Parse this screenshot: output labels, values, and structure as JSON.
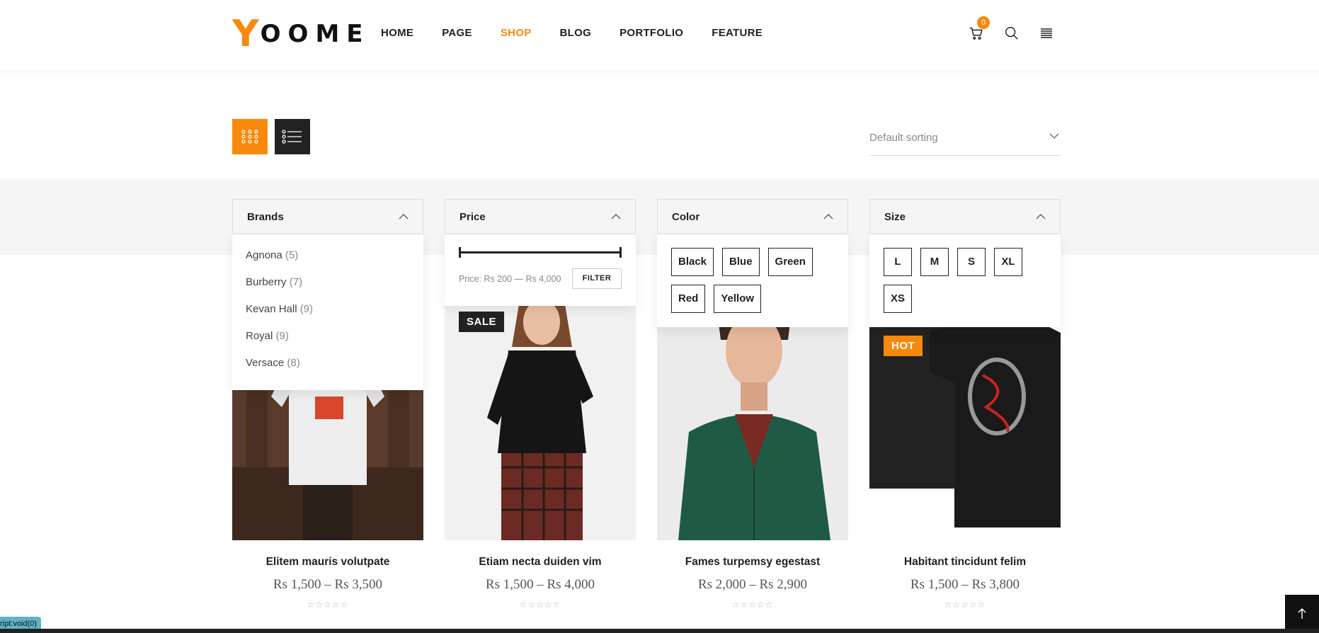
{
  "brand": {
    "logo_letter": "Y",
    "logo_rest": "OOME",
    "accent": "#f7890c"
  },
  "nav": {
    "items": [
      {
        "label": "HOME",
        "active": false
      },
      {
        "label": "PAGE",
        "active": false
      },
      {
        "label": "SHOP",
        "active": true
      },
      {
        "label": "BLOG",
        "active": false
      },
      {
        "label": "PORTFOLIO",
        "active": false
      },
      {
        "label": "FEATURE",
        "active": false
      }
    ]
  },
  "header": {
    "cart_count": "0",
    "icons": [
      "cart-icon",
      "search-icon",
      "menu-icon"
    ]
  },
  "toolbar": {
    "views": [
      "grid-view-icon",
      "list-view-icon"
    ],
    "sort_value": "Default sorting"
  },
  "filters": {
    "brands": {
      "title": "Brands",
      "items": [
        {
          "name": "Agnona",
          "count": "(5)"
        },
        {
          "name": "Burberry",
          "count": "(7)"
        },
        {
          "name": "Kevan Hall",
          "count": "(9)"
        },
        {
          "name": "Royal",
          "count": "(9)"
        },
        {
          "name": "Versace",
          "count": "(8)"
        }
      ]
    },
    "price": {
      "title": "Price",
      "label": "Price: Rs 200 — Rs 4,000",
      "button": "FILTER"
    },
    "color": {
      "title": "Color",
      "options": [
        "Black",
        "Blue",
        "Green",
        "Red",
        "Yellow"
      ]
    },
    "size": {
      "title": "Size",
      "options": [
        "L",
        "M",
        "S",
        "XL",
        "XS"
      ]
    }
  },
  "products": [
    {
      "name": "Elitem mauris volutpate",
      "price": "Rs 1,500  –  Rs 3,500",
      "badge": "",
      "rating": "☆☆☆☆☆"
    },
    {
      "name": "Etiam necta duiden vim",
      "price": "Rs 1,500  –  Rs 4,000",
      "badge": "SALE",
      "rating": "☆☆☆☆☆"
    },
    {
      "name": "Fames turpemsy egestast",
      "price": "Rs 2,000  –  Rs 2,900",
      "badge": "",
      "rating": "☆☆☆☆☆"
    },
    {
      "name": "Habitant tincidunt felim",
      "price": "Rs 1,500  –  Rs 3,800",
      "badge": "HOT",
      "rating": "☆☆☆☆☆"
    }
  ],
  "status_url": "ript:void(0)",
  "back_to_top_icon": "arrow-up-icon"
}
